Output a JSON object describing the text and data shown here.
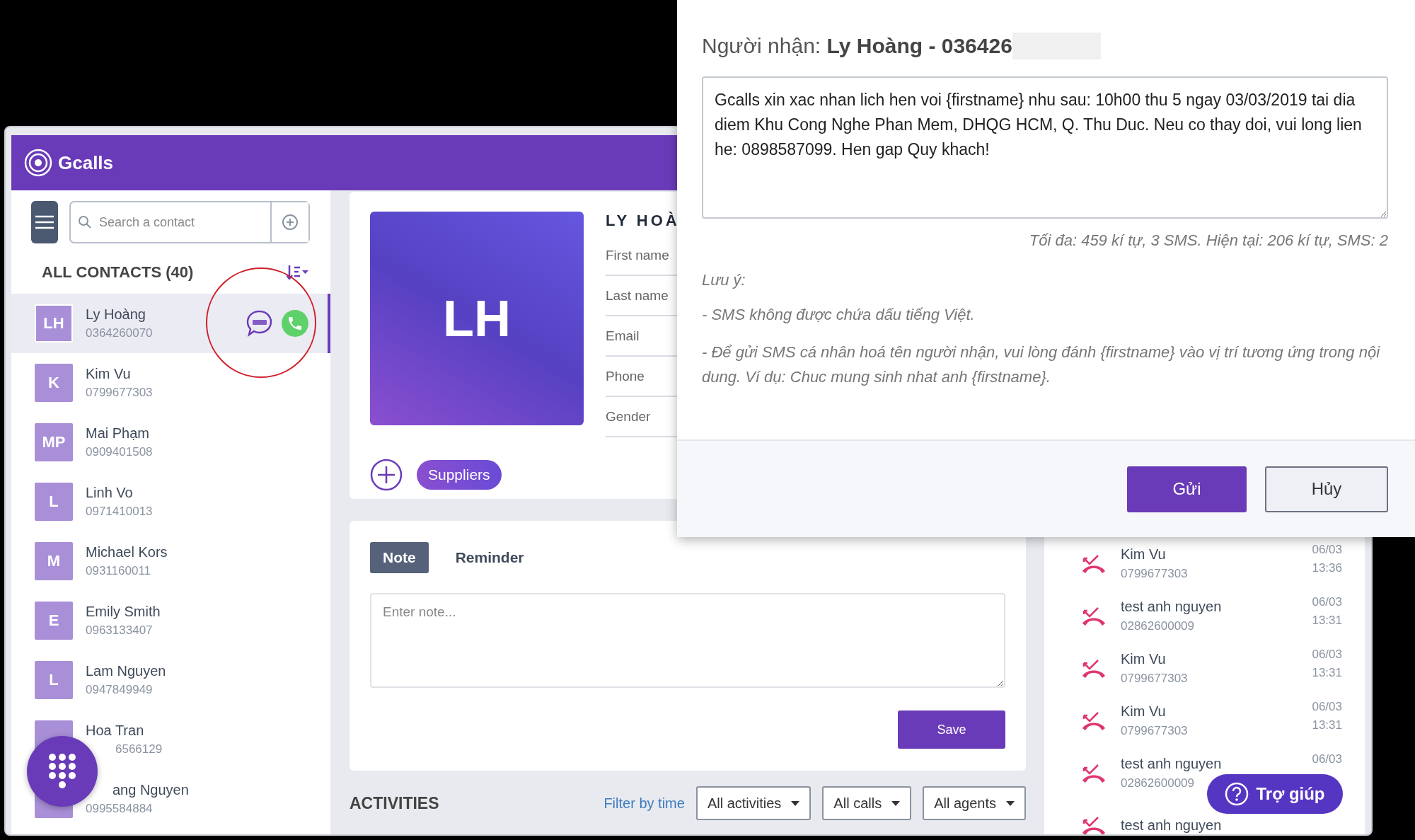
{
  "app": {
    "logo_text": "Gcalls"
  },
  "sidebar": {
    "search": {
      "placeholder": "Search a contact"
    },
    "heading": "ALL CONTACTS (40)",
    "contacts": [
      {
        "initials": "LH",
        "name": "Ly Hoàng",
        "phone": "0364260070",
        "selected": true
      },
      {
        "initials": "K",
        "name": "Kim Vu",
        "phone": "0799677303",
        "selected": false
      },
      {
        "initials": "MP",
        "name": "Mai Phạm",
        "phone": "0909401508",
        "selected": false
      },
      {
        "initials": "L",
        "name": "Linh Vo",
        "phone": "0971410013",
        "selected": false
      },
      {
        "initials": "M",
        "name": "Michael Kors",
        "phone": "0931160011",
        "selected": false
      },
      {
        "initials": "E",
        "name": "Emily Smith",
        "phone": "0963133407",
        "selected": false
      },
      {
        "initials": "L",
        "name": "Lam Nguyen",
        "phone": "0947849949",
        "selected": false
      },
      {
        "name": "Hoa Tran",
        "phone": "6566129",
        "selected": false
      },
      {
        "name": "ang Nguyen",
        "phone": "0995584884",
        "selected": false
      }
    ]
  },
  "profile": {
    "initials": "LH",
    "name": "LY HOÀ",
    "fields": [
      "First name",
      "Last name",
      "Email",
      "Phone",
      "Gender"
    ],
    "tags": [
      "Suppliers"
    ]
  },
  "notes": {
    "tabs": [
      {
        "label": "Note",
        "selected": true
      },
      {
        "label": "Reminder",
        "selected": false
      }
    ],
    "placeholder": "Enter note...",
    "save": "Save"
  },
  "activities": {
    "title": "ACTIVITIES",
    "filter_link": "Filter by time",
    "dropdowns": [
      "All activities",
      "All calls",
      "All agents"
    ]
  },
  "call_log": [
    {
      "name": "Kim Vu",
      "phone": "0799677303",
      "date": "06/03",
      "time": "13:36"
    },
    {
      "name": "test anh nguyen",
      "phone": "02862600009",
      "date": "06/03",
      "time": "13:31"
    },
    {
      "name": "Kim Vu",
      "phone": "0799677303",
      "date": "06/03",
      "time": "13:31"
    },
    {
      "name": "Kim Vu",
      "phone": "0799677303",
      "date": "06/03",
      "time": "13:31"
    },
    {
      "name": "test anh nguyen",
      "phone": "02862600009",
      "date": "06/03"
    },
    {
      "name": "test anh nguyen"
    }
  ],
  "sms_dialog": {
    "title": "Người nhận: **Ly Hoàng - 036426**",
    "message": "Gcalls xin xac nhan lich hen voi {firstname} nhu sau: 10h00 thu 5 ngay 03/03/2019 tai dia diem Khu Cong Nghe Phan Mem, DHQG HCM, Q. Thu Duc. Neu co thay doi, vui long lien he: 0898587099. Hen gap Quy khach!",
    "counter": "Tối đa: 459 kí tự, 3 SMS. Hiện tại: 206 kí tự, SMS: 2",
    "note_title": "Lưu ý:",
    "notes": [
      "- SMS không được chứa dấu tiếng Việt.",
      "- Để gửi SMS cá nhân hoá tên người nhận, vui lòng đánh {firstname} vào vị trí tương ứng trong nội dung. Ví dụ: Chuc mung sinh nhat anh {firstname}."
    ],
    "buttons": [
      {
        "label": "Gửi",
        "kind": "primary"
      },
      {
        "label": "Hủy",
        "kind": "secondary"
      }
    ]
  },
  "help_button": "Trợ giúp"
}
